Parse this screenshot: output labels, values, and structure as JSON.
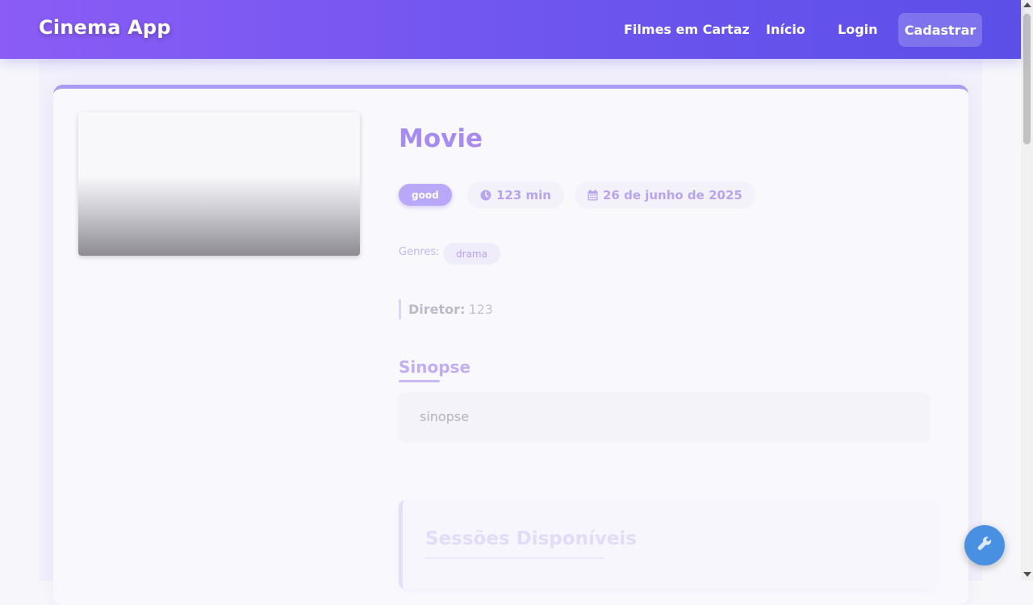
{
  "navbar": {
    "brand": "Cinema App",
    "links": [
      "Filmes em Cartaz",
      "Início",
      "Login"
    ],
    "cta_label": "Cadastrar"
  },
  "movie": {
    "title": "Movie",
    "rating_badge": "good",
    "duration": "123 min",
    "release_date": "26 de junho de 2025",
    "genres_label": "Genres:",
    "genres": [
      "drama"
    ],
    "director_label": "Diretor:",
    "director": "123",
    "synopsis_heading": "Sinopse",
    "synopsis": "sinopse",
    "sessions_heading": "Sessões Disponíveis"
  },
  "icons": {
    "duration": "clock-icon",
    "release_date": "calendar-icon",
    "fab": "wrench-icon"
  },
  "colors": {
    "navbar_start": "#8b5cf6",
    "navbar_end": "#5b4fe8",
    "accent": "#a78bf0",
    "fab": "#4a90e2"
  }
}
